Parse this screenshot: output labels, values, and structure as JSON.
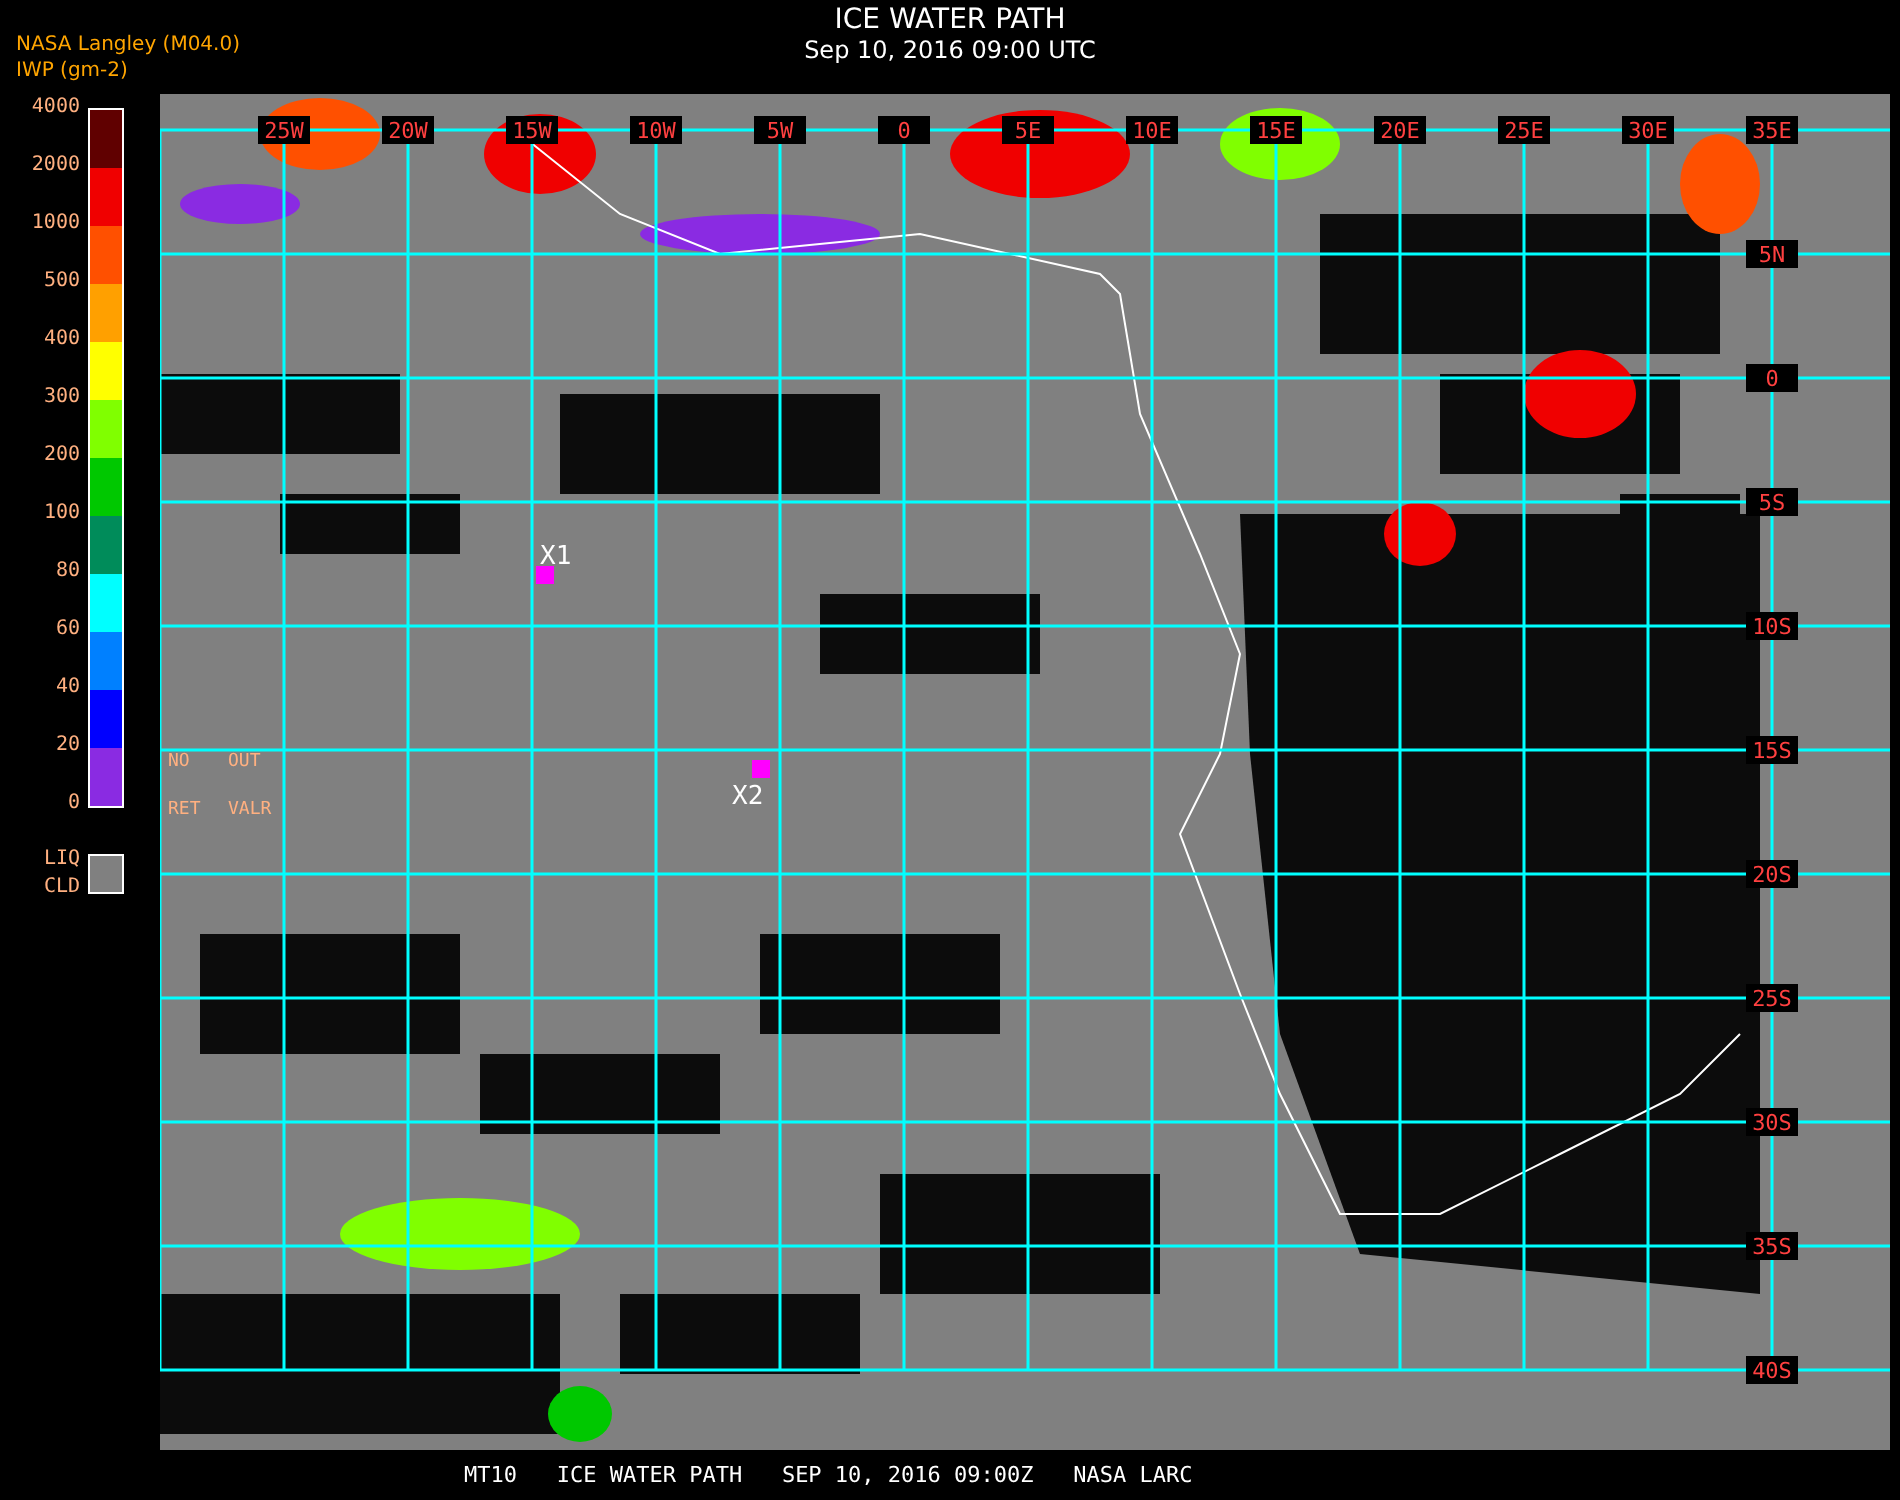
{
  "header": {
    "source": "NASA Langley (M04.0)",
    "units": "IWP (gm-2)",
    "title": "ICE WATER PATH",
    "subtitle": "Sep 10, 2016 09:00 UTC"
  },
  "legend": {
    "ticks": [
      "4000",
      "2000",
      "1000",
      "500",
      "400",
      "300",
      "200",
      "100",
      "80",
      "60",
      "40",
      "20",
      "0"
    ],
    "bins": [
      {
        "color": "#600000"
      },
      {
        "color": "#f00000"
      },
      {
        "color": "#ff5000"
      },
      {
        "color": "#ffa000"
      },
      {
        "color": "#ffff00"
      },
      {
        "color": "#80ff00"
      },
      {
        "color": "#00c800"
      },
      {
        "color": "#008c5a"
      },
      {
        "color": "#00ffff"
      },
      {
        "color": "#0080ff"
      },
      {
        "color": "#0000ff"
      },
      {
        "color": "#8a2be2"
      }
    ],
    "liq_cld": {
      "label_top": "LIQ",
      "label_bottom": "CLD",
      "color": "#808080"
    }
  },
  "map": {
    "lon_labels": [
      "25W",
      "20W",
      "15W",
      "10W",
      "5W",
      "0",
      "5E",
      "10E",
      "15E",
      "20E",
      "25E",
      "30E",
      "35E"
    ],
    "lat_labels": [
      "5N",
      "0",
      "5S",
      "10S",
      "15S",
      "20S",
      "25S",
      "30S",
      "35S",
      "40S"
    ],
    "notes": [
      {
        "top": "NO",
        "bottom": "RET"
      },
      {
        "top": "OUT",
        "bottom": "VALR"
      }
    ],
    "markers": [
      {
        "label": "X1"
      },
      {
        "label": "X2"
      }
    ]
  },
  "footer": "MT10   ICE WATER PATH   SEP 10, 2016 09:00Z   NASA LARC"
}
